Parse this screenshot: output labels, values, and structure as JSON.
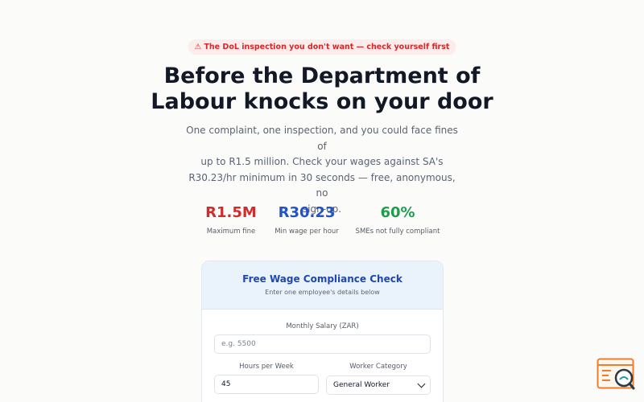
{
  "banner": {
    "icon": "warning-icon",
    "text": "⚠ The DoL inspection you don't want — check yourself first"
  },
  "hero": {
    "title_line1": "Before the Department of",
    "title_line2": "Labour knocks on your door",
    "subtitle_line1": "One complaint, one inspection, and you could face fines of",
    "subtitle_line2": "up to R1.5 million. Check your wages against SA's",
    "subtitle_line3": "R30.23/hr minimum in 30 seconds — free, anonymous, no",
    "subtitle_line4": "sign-up."
  },
  "stats": [
    {
      "value": "R1.5M",
      "label": "Maximum fine",
      "color": "#d12c2c"
    },
    {
      "value": "R30.23",
      "label": "Min wage per hour",
      "color": "#2452c7"
    },
    {
      "value": "60%",
      "label": "SMEs not fully compliant",
      "color": "#1f9d4c"
    }
  ],
  "form": {
    "title": "Free Wage Compliance Check",
    "subtitle": "Enter one employee's details below",
    "salary_label": "Monthly Salary (ZAR)",
    "salary_placeholder": "e.g. 5500",
    "salary_value": "",
    "hours_label": "Hours per Week",
    "hours_value": "45",
    "category_label": "Worker Category",
    "category_selected": "General Worker"
  },
  "widget": {
    "icon": "search-window-icon"
  },
  "colors": {
    "accent_blue": "#2452c7",
    "alert_red": "#d62828",
    "success_green": "#1f9d4c",
    "widget_orange": "#f07c2c"
  }
}
